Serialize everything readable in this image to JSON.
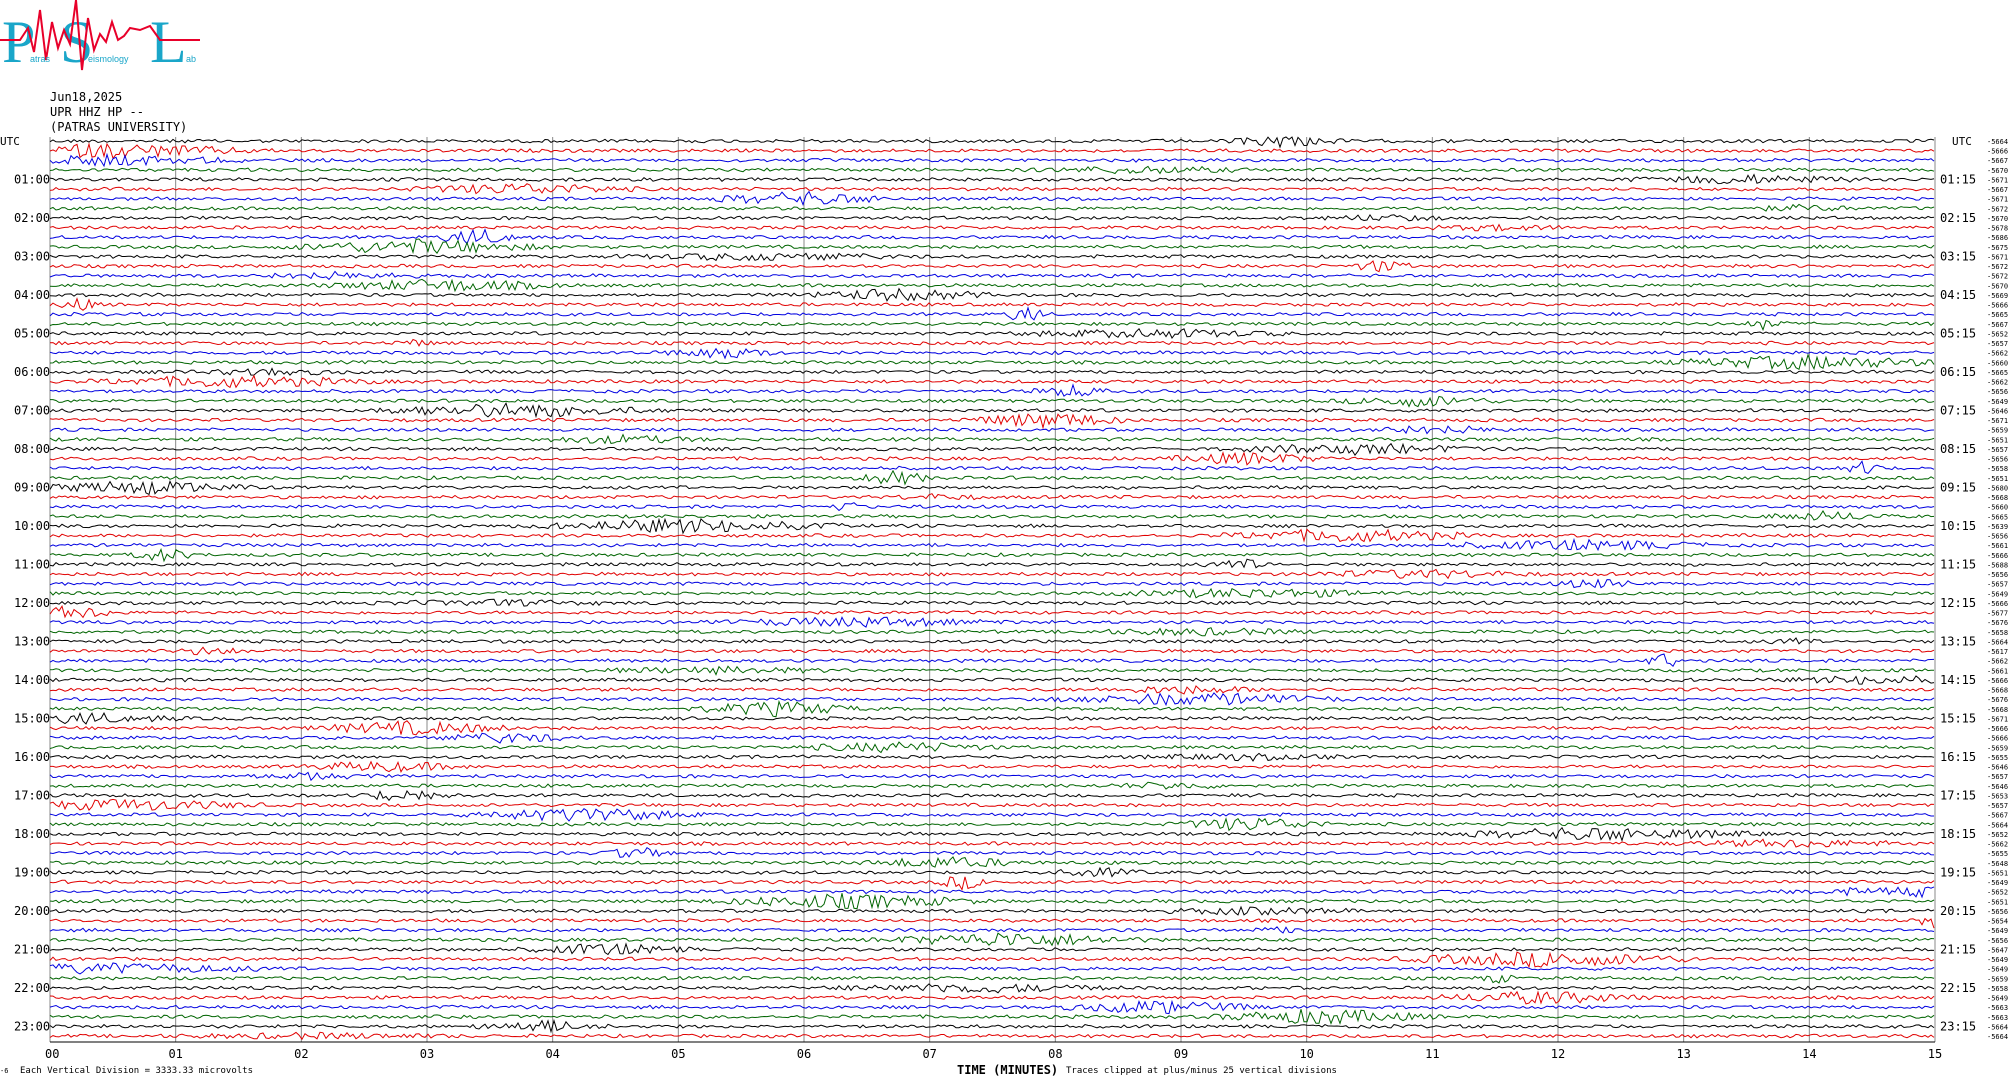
{
  "header": {
    "date": "Jun18,2025",
    "station": "UPR HHZ HP --",
    "institution": "(PATRAS UNIVERSITY)"
  },
  "logo": {
    "letters": [
      "P",
      "S",
      "L"
    ],
    "small_text": [
      "atras",
      "eismology",
      "ab"
    ],
    "colors": {
      "letters": "#1aa6c9",
      "wave": "#e8002a"
    }
  },
  "chart_data": {
    "type": "helicorder",
    "left_axis_label": "UTC",
    "right_axis_label": "UTC",
    "left_hour_labels": [
      "01:00",
      "02:00",
      "03:00",
      "04:00",
      "05:00",
      "06:00",
      "07:00",
      "08:00",
      "09:00",
      "10:00",
      "11:00",
      "12:00",
      "13:00",
      "14:00",
      "15:00",
      "16:00",
      "17:00",
      "18:00",
      "19:00",
      "20:00",
      "21:00",
      "22:00",
      "23:00"
    ],
    "right_hour_labels": [
      "01:15",
      "02:15",
      "03:15",
      "04:15",
      "05:15",
      "06:15",
      "07:15",
      "08:15",
      "09:15",
      "10:15",
      "11:15",
      "12:15",
      "13:15",
      "14:15",
      "15:15",
      "16:15",
      "17:15",
      "18:15",
      "19:15",
      "20:15",
      "21:15",
      "22:15",
      "23:15"
    ],
    "x_ticks": [
      "00",
      "01",
      "02",
      "03",
      "04",
      "05",
      "06",
      "07",
      "08",
      "09",
      "10",
      "11",
      "12",
      "13",
      "14",
      "15"
    ],
    "xlabel": "TIME (MINUTES)",
    "trace_colors": [
      "#000000",
      "#e00000",
      "#0000e0",
      "#006400"
    ],
    "trace_count": 94,
    "right_offsets": [
      "-5664",
      "-5666",
      "-5667",
      "-5670",
      "-5671",
      "-5667",
      "-5671",
      "-5672",
      "-5670",
      "-5678",
      "-5686",
      "-5675",
      "-5671",
      "-5672",
      "-5672",
      "-5670",
      "-5669",
      "-5666",
      "-5665",
      "-5667",
      "-5652",
      "-5657",
      "-5662",
      "-5660",
      "-5665",
      "-5662",
      "-5656",
      "-5649",
      "-5646",
      "-5671",
      "-5659",
      "-5651",
      "-5657",
      "-5656",
      "-5658",
      "-5651",
      "-5680",
      "-5668",
      "-5660",
      "-5665",
      "-5639",
      "-5656",
      "-5661",
      "-5666",
      "-5688",
      "-5656",
      "-5657",
      "-5649",
      "-5666",
      "-5677",
      "-5676",
      "-5658",
      "-5664",
      "-5617",
      "-5662",
      "-5661",
      "-5666",
      "-5668",
      "-5676",
      "-5668",
      "-5671",
      "-5666",
      "-5666",
      "-5659",
      "-5655",
      "-5646",
      "-5657",
      "-5646",
      "-5653",
      "-5657",
      "-5667",
      "-5664",
      "-5652",
      "-5662",
      "-5655",
      "-5648",
      "-5651",
      "-5649",
      "-5652",
      "-5651",
      "-5656",
      "-5654",
      "-5649",
      "-5656",
      "-5647",
      "-5649",
      "-5649",
      "-5659",
      "-5658",
      "-5649",
      "-5663",
      "-5663",
      "-5664",
      "-5664"
    ],
    "footer_left": "Each Vertical Division = 3333.33 microvolts",
    "footer_right": "Traces clipped at plus/minus 25 vertical divisions",
    "footer_mark": "-6"
  }
}
